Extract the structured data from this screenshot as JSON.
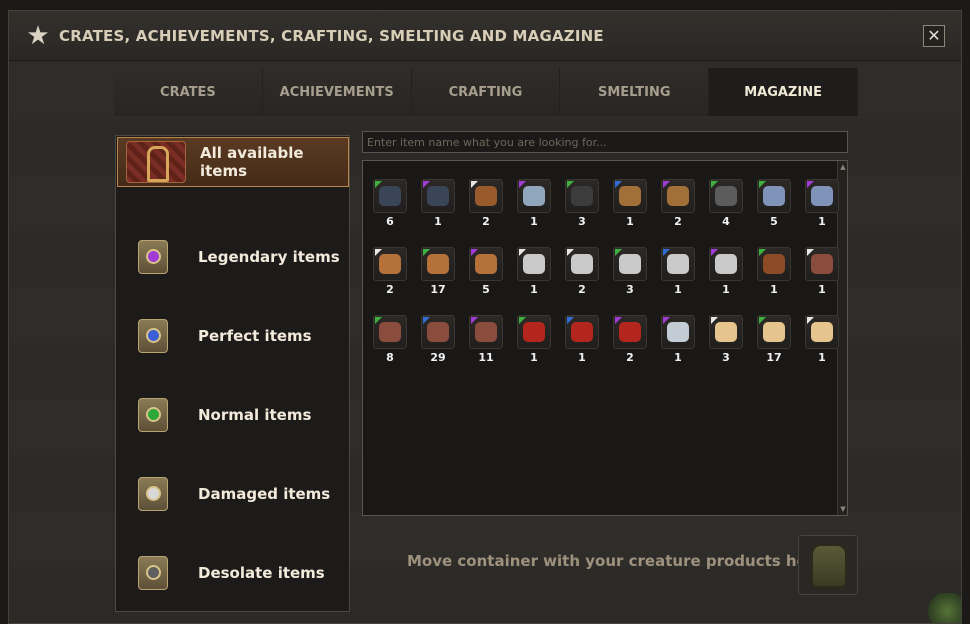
{
  "window": {
    "title": "CRATES, ACHIEVEMENTS, CRAFTING, SMELTING AND MAGAZINE",
    "close_label": "✕",
    "star_icon": "★"
  },
  "tabs": [
    {
      "label": "CRATES",
      "active": false
    },
    {
      "label": "ACHIEVEMENTS",
      "active": false
    },
    {
      "label": "CRAFTING",
      "active": false
    },
    {
      "label": "SMELTING",
      "active": false
    },
    {
      "label": "MAGAZINE",
      "active": true
    }
  ],
  "sidebar": {
    "items": [
      {
        "label": "All available items",
        "icon": "bag-icon",
        "active": true
      },
      {
        "label": "Legendary items",
        "icon": "purple-orb-icon",
        "orb_color": "#a13bd6",
        "active": false
      },
      {
        "label": "Perfect items",
        "icon": "blue-orb-icon",
        "orb_color": "#3b5fd6",
        "active": false
      },
      {
        "label": "Normal items",
        "icon": "green-orb-icon",
        "orb_color": "#2fa83a",
        "active": false
      },
      {
        "label": "Damaged items",
        "icon": "white-orb-icon",
        "orb_color": "#d8d8d8",
        "active": false
      },
      {
        "label": "Desolate items",
        "icon": "grey-orb-icon",
        "orb_color": "#5f5f5f",
        "active": false
      }
    ]
  },
  "search": {
    "placeholder": "Enter item name what you are looking for..."
  },
  "grid": {
    "rows": [
      [
        {
          "icon": "claw-icon",
          "rarity": "green",
          "color": "#3a4558",
          "count": "6"
        },
        {
          "icon": "claw-icon",
          "rarity": "purple",
          "color": "#3a4558",
          "count": "1"
        },
        {
          "icon": "hide-icon",
          "rarity": "white",
          "color": "#9a5b2c",
          "count": "2"
        },
        {
          "icon": "skull-icon",
          "rarity": "purple",
          "color": "#8fa6bd",
          "count": "1"
        },
        {
          "icon": "stone-icon",
          "rarity": "green",
          "color": "#3c3c3c",
          "count": "3"
        },
        {
          "icon": "fur-icon",
          "rarity": "blue",
          "color": "#a07038",
          "count": "1"
        },
        {
          "icon": "fur-icon",
          "rarity": "purple",
          "color": "#a07038",
          "count": "2"
        },
        {
          "icon": "horn-icon",
          "rarity": "green",
          "color": "#5c5c5c",
          "count": "4"
        },
        {
          "icon": "crystal-icon",
          "rarity": "green",
          "color": "#7f94b8",
          "count": "5"
        },
        {
          "icon": "crystal-icon",
          "rarity": "purple",
          "color": "#7f94b8",
          "count": "1"
        }
      ],
      [
        {
          "icon": "feather-icon",
          "rarity": "white",
          "color": "#b5713a",
          "count": "2"
        },
        {
          "icon": "feather-icon",
          "rarity": "green",
          "color": "#b5713a",
          "count": "17"
        },
        {
          "icon": "feather-icon",
          "rarity": "purple",
          "color": "#b5713a",
          "count": "5"
        },
        {
          "icon": "bone-icon",
          "rarity": "white",
          "color": "#c9c9c9",
          "count": "1"
        },
        {
          "icon": "bone-icon",
          "rarity": "white",
          "color": "#c9c9c9",
          "count": "2"
        },
        {
          "icon": "bone-icon",
          "rarity": "green",
          "color": "#c9c9c9",
          "count": "3"
        },
        {
          "icon": "bone-icon",
          "rarity": "blue",
          "color": "#c9c9c9",
          "count": "1"
        },
        {
          "icon": "bone-icon",
          "rarity": "purple",
          "color": "#c9c9c9",
          "count": "1"
        },
        {
          "icon": "rope-icon",
          "rarity": "green",
          "color": "#8c4b24",
          "count": "1"
        },
        {
          "icon": "meat-icon",
          "rarity": "white",
          "color": "#8a4c3c",
          "count": "1"
        }
      ],
      [
        {
          "icon": "meat-icon",
          "rarity": "green",
          "color": "#8a4c3c",
          "count": "8"
        },
        {
          "icon": "meat-icon",
          "rarity": "blue",
          "color": "#8a4c3c",
          "count": "29"
        },
        {
          "icon": "meat-icon",
          "rarity": "purple",
          "color": "#8a4c3c",
          "count": "11"
        },
        {
          "icon": "cloth-icon",
          "rarity": "green",
          "color": "#b3261e",
          "count": "1"
        },
        {
          "icon": "cloth-icon",
          "rarity": "blue",
          "color": "#b3261e",
          "count": "1"
        },
        {
          "icon": "cloth-icon",
          "rarity": "purple",
          "color": "#b3261e",
          "count": "2"
        },
        {
          "icon": "metal-icon",
          "rarity": "purple",
          "color": "#c3cbd4",
          "count": "1"
        },
        {
          "icon": "scroll-icon",
          "rarity": "white",
          "color": "#e6c48e",
          "count": "3"
        },
        {
          "icon": "scroll-icon",
          "rarity": "green",
          "color": "#e6c48e",
          "count": "17"
        },
        {
          "icon": "scroll-icon",
          "rarity": "white",
          "color": "#e6c48e",
          "count": "1"
        }
      ]
    ]
  },
  "rarity_colors": {
    "green": "#3fb13f",
    "purple": "#a43bd6",
    "blue": "#2f6ed6",
    "white": "#e6e6e6"
  },
  "footer": {
    "hint": "Move container with your creature products here",
    "container_icon": "backpack-icon"
  }
}
